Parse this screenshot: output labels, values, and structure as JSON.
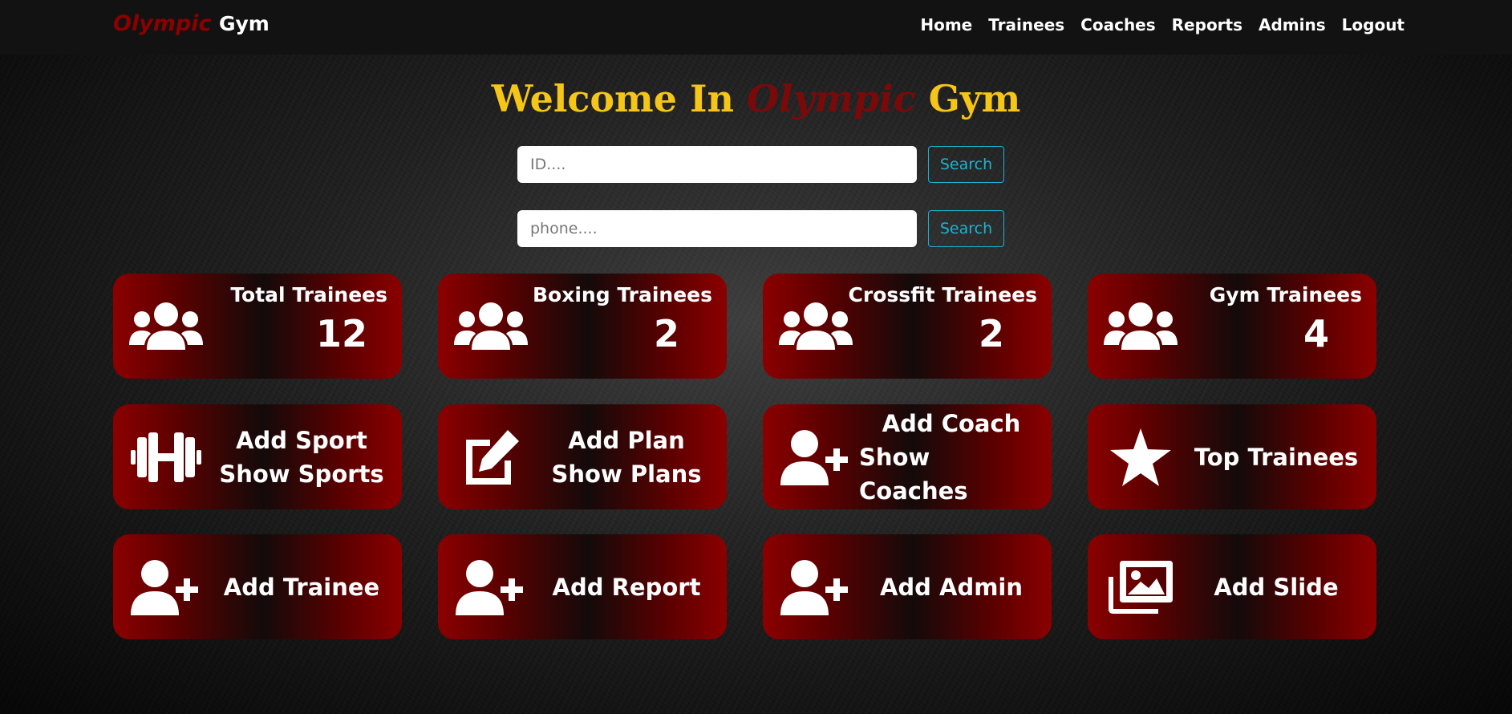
{
  "nav": {
    "brand_part1": "Olympic",
    "brand_part2": "Gym",
    "links": [
      "Home",
      "Trainees",
      "Coaches",
      "Reports",
      "Admins",
      "Logout"
    ]
  },
  "welcome": {
    "part1": "Welcome In",
    "part2": "Olympic",
    "part3": "Gym"
  },
  "search": {
    "id_placeholder": "ID....",
    "phone_placeholder": "phone....",
    "button_label": "Search"
  },
  "stats": [
    {
      "label": "Total Trainees",
      "value": "12",
      "icon": "users-icon"
    },
    {
      "label": "Boxing Trainees",
      "value": "2",
      "icon": "users-icon"
    },
    {
      "label": "Crossfit Trainees",
      "value": "2",
      "icon": "users-icon"
    },
    {
      "label": "Gym Trainees",
      "value": "4",
      "icon": "users-icon"
    }
  ],
  "actions_row1": [
    {
      "line1": "Add Sport",
      "line2": "Show Sports",
      "icon": "dumbbell-icon"
    },
    {
      "line1": "Add Plan",
      "line2": "Show Plans",
      "icon": "edit-icon"
    },
    {
      "line1": "Add Coach",
      "line2": "Show Coaches",
      "icon": "user-plus-icon"
    },
    {
      "line1": "Top Trainees",
      "icon": "star-icon"
    }
  ],
  "actions_row2": [
    {
      "line1": "Add Trainee",
      "icon": "user-plus-icon"
    },
    {
      "line1": "Add Report",
      "icon": "user-plus-icon"
    },
    {
      "line1": "Add Admin",
      "icon": "user-plus-icon"
    },
    {
      "line1": "Add Slide",
      "icon": "images-icon"
    }
  ],
  "colors": {
    "brand_red": "#8b0000",
    "title_gold": "#f5c518",
    "search_accent": "#1bb3d1"
  }
}
